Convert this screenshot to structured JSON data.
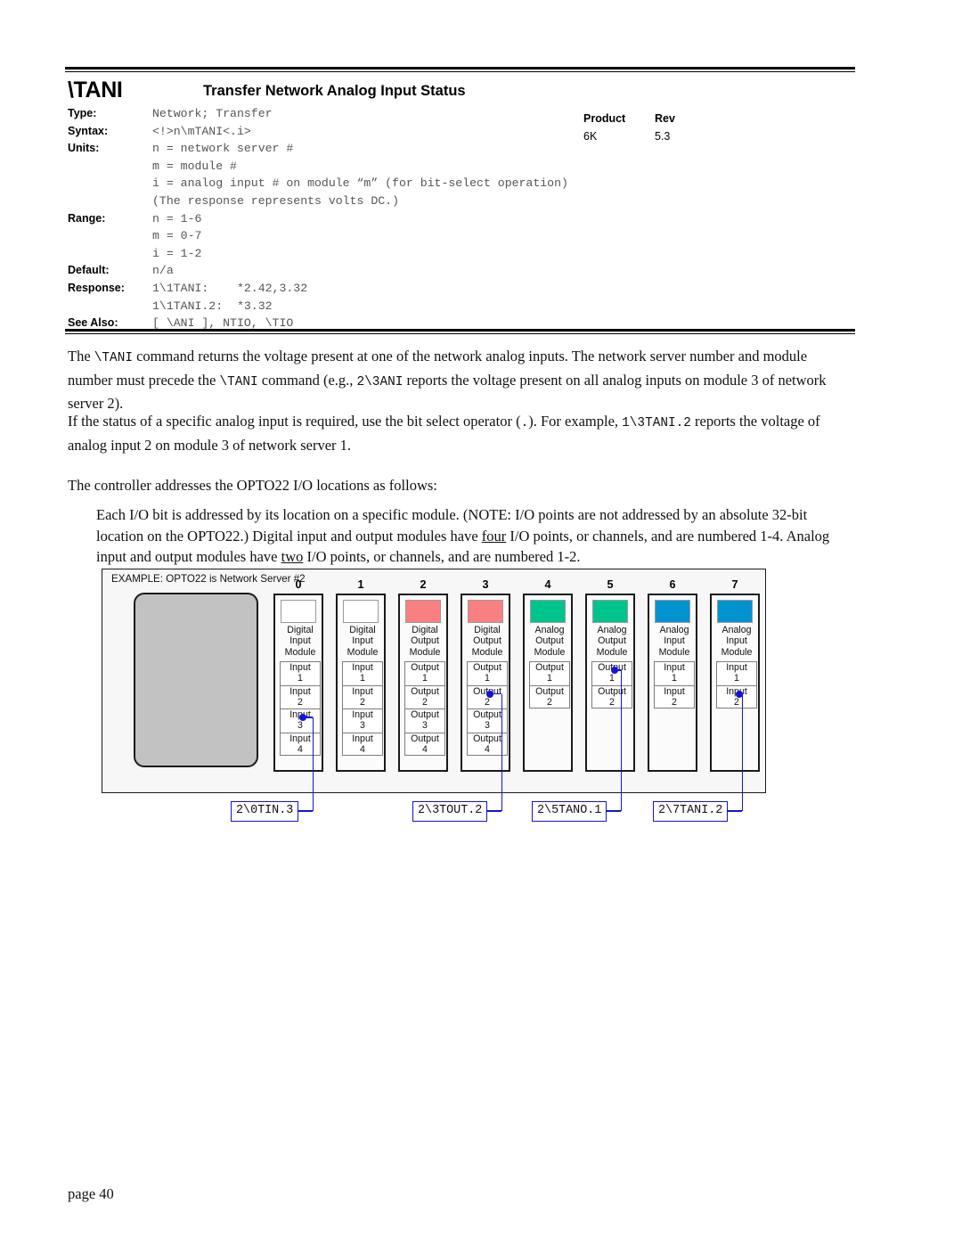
{
  "header": {
    "command": "\\TANI",
    "title": "Transfer Network Analog Input Status",
    "product_header": "Product",
    "rev_header": "Rev",
    "product_value": "6K",
    "rev_value": "5.3"
  },
  "spec": {
    "rows": [
      {
        "label": "Type:",
        "value": "Network; Transfer"
      },
      {
        "label": "Syntax:",
        "value": "<!>n\\mTANI<.i>"
      },
      {
        "label": "Units:",
        "value": "n = network server #"
      },
      {
        "label": "",
        "value": "m = module #"
      },
      {
        "label": "",
        "value": "i = analog input # on module “m” (for bit-select operation)"
      },
      {
        "label": "",
        "value": "(The response represents volts DC.)"
      },
      {
        "label": "Range:",
        "value": "n = 1-6"
      },
      {
        "label": "",
        "value": "m = 0-7"
      },
      {
        "label": "",
        "value": "i = 1-2"
      },
      {
        "label": "Default:",
        "value": "n/a"
      },
      {
        "label": "Response:",
        "value": "1\\1TANI:    *2.42,3.32"
      },
      {
        "label": "",
        "value": "1\\1TANI.2:  *3.32"
      },
      {
        "label": "See Also:",
        "value": "[ \\ANI ], NTIO, \\TIO"
      }
    ]
  },
  "body": {
    "para1_a": "The ",
    "para1_cmd1": "\\TANI",
    "para1_b": " command returns the voltage present at one of the network analog inputs. The network server number and module number must precede the ",
    "para1_cmd2": "\\TANI",
    "para1_c": " command (e.g., ",
    "para1_cmd3": "2\\3ANI",
    "para1_d": " reports the voltage present on all analog inputs on module 3 of network server 2).",
    "para2_a": "If the status of a specific analog input is required, use the bit select operator (",
    "para2_cmd1": ".",
    "para2_b": "). For example, ",
    "para2_cmd2": "1\\3TANI.2",
    "para2_c": " reports the voltage of analog input 2 on module 3 of network server 1.",
    "para3": "The controller addresses the OPTO22 I/O locations as follows:",
    "para4_a": "Each I/O bit is addressed by its location on a specific module. (NOTE: I/O points are not addressed by an absolute 32-bit location on the OPTO22.) Digital input and output modules have ",
    "para4_u1": "four",
    "para4_b": " I/O points, or channels, and are numbered 1-4. Analog input and output modules have ",
    "para4_u2": "two",
    "para4_c": " I/O points, or channels, and are numbered 1-2."
  },
  "diagram": {
    "caption": "EXAMPLE: OPTO22 is Network Server #2",
    "colors": {
      "digital_input": "#ffffff",
      "digital_output": "#f98080",
      "analog_output": "#00c48c",
      "analog_input": "#0093d0",
      "brain": "#c2c2c2",
      "dot": "#1313d8",
      "callout_border": "#1313d8"
    },
    "modules": [
      {
        "num": "0",
        "name": "Digital\nInput\nModule",
        "type": "digital_input",
        "channels": [
          "Input\n1",
          "Input\n2",
          "Input\n3",
          "Input\n4"
        ]
      },
      {
        "num": "1",
        "name": "Digital\nInput\nModule",
        "type": "digital_input",
        "channels": [
          "Input\n1",
          "Input\n2",
          "Input\n3",
          "Input\n4"
        ]
      },
      {
        "num": "2",
        "name": "Digital\nOutput\nModule",
        "type": "digital_output",
        "channels": [
          "Output\n1",
          "Output\n2",
          "Output\n3",
          "Output\n4"
        ]
      },
      {
        "num": "3",
        "name": "Digital\nOutput\nModule",
        "type": "digital_output",
        "channels": [
          "Output\n1",
          "Output\n2",
          "Output\n3",
          "Output\n4"
        ]
      },
      {
        "num": "4",
        "name": "Analog\nOutput\nModule",
        "type": "analog_output",
        "channels": [
          "Output\n1",
          "Output\n2"
        ]
      },
      {
        "num": "5",
        "name": "Analog\nOutput\nModule",
        "type": "analog_output",
        "channels": [
          "Output\n1",
          "Output\n2"
        ]
      },
      {
        "num": "6",
        "name": "Analog\nInput\nModule",
        "type": "analog_input",
        "channels": [
          "Input\n1",
          "Input\n2"
        ]
      },
      {
        "num": "7",
        "name": "Analog\nInput\nModule",
        "type": "analog_input",
        "channels": [
          "Input\n1",
          "Input\n2"
        ]
      }
    ],
    "callouts": [
      {
        "label": "2\\0TIN.3",
        "module": "0",
        "channel": "Input 3"
      },
      {
        "label": "2\\3TOUT.2",
        "module": "3",
        "channel": "Output 2"
      },
      {
        "label": "2\\5TANO.1",
        "module": "5",
        "channel": "Output 1"
      },
      {
        "label": "2\\7TANI.2",
        "module": "7",
        "channel": "Input 2"
      }
    ]
  },
  "footer": {
    "page": "page 40"
  }
}
